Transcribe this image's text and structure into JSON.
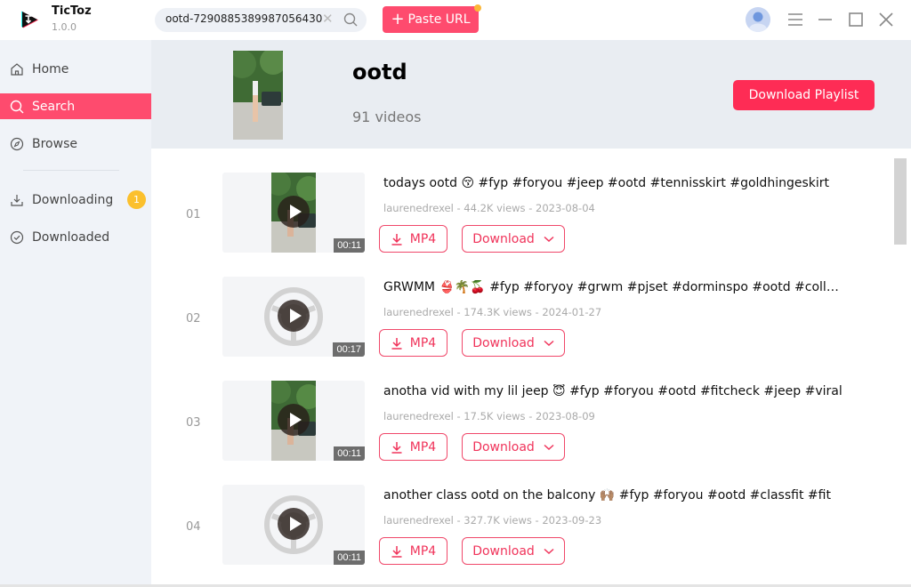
{
  "app": {
    "name": "TicToz",
    "version": "1.0.0"
  },
  "search": {
    "value": "ootd-7290885389987056430",
    "clear_glyph": "✕"
  },
  "paste_button": {
    "plus": "+",
    "label": "Paste URL"
  },
  "colors": {
    "accent": "#fe4b6e",
    "primary_button": "#fe2c55",
    "badge": "#fbc02d",
    "sidebar_bg": "#f0f3f8",
    "header_bg": "#e9edf2"
  },
  "sidebar": {
    "items": [
      {
        "label": "Home",
        "icon": "home-icon",
        "active": false
      },
      {
        "label": "Search",
        "icon": "search-icon",
        "active": true
      },
      {
        "label": "Browse",
        "icon": "compass-icon",
        "active": false
      },
      {
        "label": "Downloading",
        "icon": "download-tray-icon",
        "active": false,
        "badge": "1"
      },
      {
        "label": "Downloaded",
        "icon": "check-circle-icon",
        "active": false
      }
    ]
  },
  "playlist": {
    "title": "ootd",
    "count_label": "91  videos",
    "download_all_label": "Download Playlist"
  },
  "videos": [
    {
      "index": "01",
      "title": "todays ootd 😚 #fyp #foryou #jeep #ootd #tennisskirt #goldhingeskirt",
      "meta": "laurenedrexel - 44.2K views - 2023-08-04",
      "duration": "00:11",
      "has_photo": true,
      "mp4_label": "MP4",
      "download_label": "Download"
    },
    {
      "index": "02",
      "title": "GRWMM 👙🌴🍒 #fyp #foryoy #grwm #pjset #dorminspo #ootd #college",
      "meta": "laurenedrexel - 174.3K views - 2024-01-27",
      "duration": "00:17",
      "has_photo": false,
      "mp4_label": "MP4",
      "download_label": "Download"
    },
    {
      "index": "03",
      "title": "anotha vid with my lil jeep 😇 #fyp #foryou #ootd #fitcheck #jeep #viral",
      "meta": "laurenedrexel - 17.5K views - 2023-08-09",
      "duration": "00:11",
      "has_photo": true,
      "mp4_label": "MP4",
      "download_label": "Download"
    },
    {
      "index": "04",
      "title": "another class ootd on the balcony 🙌🏽 #fyp #foryou #ootd #classfit #fit",
      "meta": "laurenedrexel - 327.7K views - 2023-09-23",
      "duration": "00:11",
      "has_photo": false,
      "mp4_label": "MP4",
      "download_label": "Download"
    }
  ]
}
